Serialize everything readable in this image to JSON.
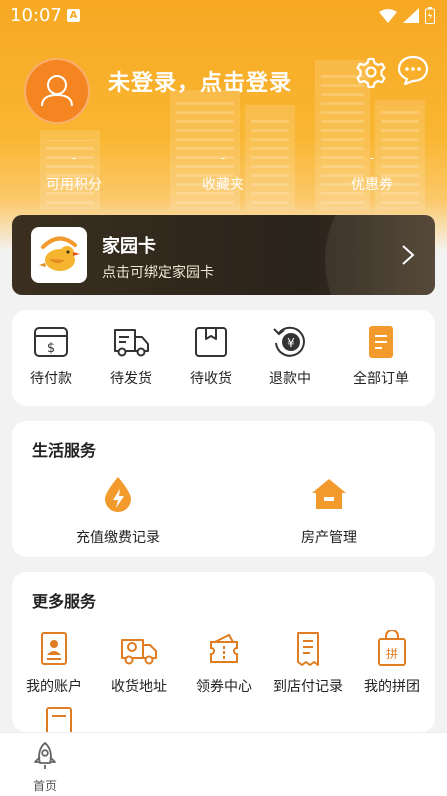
{
  "status_bar": {
    "time": "10:07",
    "notification_glyph": "A"
  },
  "profile": {
    "login_prompt": "未登录，点击登录"
  },
  "stats": [
    {
      "value": "-",
      "label": "可用积分"
    },
    {
      "value": "-",
      "label": "收藏夹"
    },
    {
      "value": "-",
      "label": "优惠券"
    }
  ],
  "home_card": {
    "title": "家园卡",
    "subtitle": "点击可绑定家园卡"
  },
  "orders": [
    {
      "label": "待付款",
      "icon": "wallet-icon"
    },
    {
      "label": "待发货",
      "icon": "delivery-truck-icon"
    },
    {
      "label": "待收货",
      "icon": "package-box-icon"
    },
    {
      "label": "退款中",
      "icon": "yuan-refund-icon"
    },
    {
      "label": "全部订单",
      "icon": "order-list-icon"
    }
  ],
  "life_services": {
    "title": "生活服务",
    "items": [
      {
        "label": "充值缴费记录",
        "icon": "recharge-drop-icon"
      },
      {
        "label": "房产管理",
        "icon": "house-icon"
      }
    ]
  },
  "more_services": {
    "title": "更多服务",
    "items": [
      {
        "label": "我的账户",
        "icon": "account-icon"
      },
      {
        "label": "收货地址",
        "icon": "truck-address-icon"
      },
      {
        "label": "领券中心",
        "icon": "coupon-icon"
      },
      {
        "label": "到店付记录",
        "icon": "receipt-icon"
      },
      {
        "label": "我的拼团",
        "icon": "group-buy-bag-icon"
      }
    ]
  },
  "tabbar": {
    "home_label": "首页"
  },
  "colors": {
    "accent": "#f7a823",
    "icon_orange": "#f39a2c",
    "dark_card": "#2f271c"
  }
}
